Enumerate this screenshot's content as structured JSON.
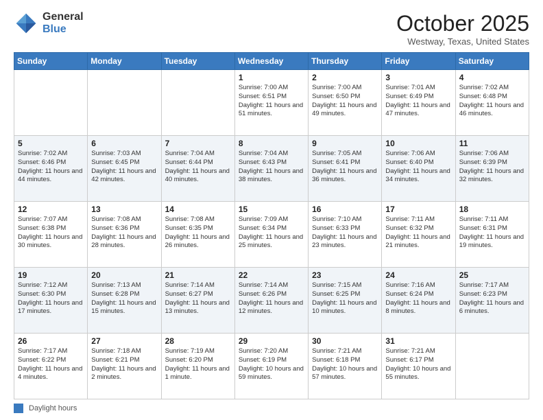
{
  "logo": {
    "general": "General",
    "blue": "Blue"
  },
  "header": {
    "month": "October 2025",
    "location": "Westway, Texas, United States"
  },
  "weekdays": [
    "Sunday",
    "Monday",
    "Tuesday",
    "Wednesday",
    "Thursday",
    "Friday",
    "Saturday"
  ],
  "footer": {
    "legend": "Daylight hours"
  },
  "weeks": [
    [
      {
        "day": "",
        "info": ""
      },
      {
        "day": "",
        "info": ""
      },
      {
        "day": "",
        "info": ""
      },
      {
        "day": "1",
        "info": "Sunrise: 7:00 AM\nSunset: 6:51 PM\nDaylight: 11 hours\nand 51 minutes."
      },
      {
        "day": "2",
        "info": "Sunrise: 7:00 AM\nSunset: 6:50 PM\nDaylight: 11 hours\nand 49 minutes."
      },
      {
        "day": "3",
        "info": "Sunrise: 7:01 AM\nSunset: 6:49 PM\nDaylight: 11 hours\nand 47 minutes."
      },
      {
        "day": "4",
        "info": "Sunrise: 7:02 AM\nSunset: 6:48 PM\nDaylight: 11 hours\nand 46 minutes."
      }
    ],
    [
      {
        "day": "5",
        "info": "Sunrise: 7:02 AM\nSunset: 6:46 PM\nDaylight: 11 hours\nand 44 minutes."
      },
      {
        "day": "6",
        "info": "Sunrise: 7:03 AM\nSunset: 6:45 PM\nDaylight: 11 hours\nand 42 minutes."
      },
      {
        "day": "7",
        "info": "Sunrise: 7:04 AM\nSunset: 6:44 PM\nDaylight: 11 hours\nand 40 minutes."
      },
      {
        "day": "8",
        "info": "Sunrise: 7:04 AM\nSunset: 6:43 PM\nDaylight: 11 hours\nand 38 minutes."
      },
      {
        "day": "9",
        "info": "Sunrise: 7:05 AM\nSunset: 6:41 PM\nDaylight: 11 hours\nand 36 minutes."
      },
      {
        "day": "10",
        "info": "Sunrise: 7:06 AM\nSunset: 6:40 PM\nDaylight: 11 hours\nand 34 minutes."
      },
      {
        "day": "11",
        "info": "Sunrise: 7:06 AM\nSunset: 6:39 PM\nDaylight: 11 hours\nand 32 minutes."
      }
    ],
    [
      {
        "day": "12",
        "info": "Sunrise: 7:07 AM\nSunset: 6:38 PM\nDaylight: 11 hours\nand 30 minutes."
      },
      {
        "day": "13",
        "info": "Sunrise: 7:08 AM\nSunset: 6:36 PM\nDaylight: 11 hours\nand 28 minutes."
      },
      {
        "day": "14",
        "info": "Sunrise: 7:08 AM\nSunset: 6:35 PM\nDaylight: 11 hours\nand 26 minutes."
      },
      {
        "day": "15",
        "info": "Sunrise: 7:09 AM\nSunset: 6:34 PM\nDaylight: 11 hours\nand 25 minutes."
      },
      {
        "day": "16",
        "info": "Sunrise: 7:10 AM\nSunset: 6:33 PM\nDaylight: 11 hours\nand 23 minutes."
      },
      {
        "day": "17",
        "info": "Sunrise: 7:11 AM\nSunset: 6:32 PM\nDaylight: 11 hours\nand 21 minutes."
      },
      {
        "day": "18",
        "info": "Sunrise: 7:11 AM\nSunset: 6:31 PM\nDaylight: 11 hours\nand 19 minutes."
      }
    ],
    [
      {
        "day": "19",
        "info": "Sunrise: 7:12 AM\nSunset: 6:30 PM\nDaylight: 11 hours\nand 17 minutes."
      },
      {
        "day": "20",
        "info": "Sunrise: 7:13 AM\nSunset: 6:28 PM\nDaylight: 11 hours\nand 15 minutes."
      },
      {
        "day": "21",
        "info": "Sunrise: 7:14 AM\nSunset: 6:27 PM\nDaylight: 11 hours\nand 13 minutes."
      },
      {
        "day": "22",
        "info": "Sunrise: 7:14 AM\nSunset: 6:26 PM\nDaylight: 11 hours\nand 12 minutes."
      },
      {
        "day": "23",
        "info": "Sunrise: 7:15 AM\nSunset: 6:25 PM\nDaylight: 11 hours\nand 10 minutes."
      },
      {
        "day": "24",
        "info": "Sunrise: 7:16 AM\nSunset: 6:24 PM\nDaylight: 11 hours\nand 8 minutes."
      },
      {
        "day": "25",
        "info": "Sunrise: 7:17 AM\nSunset: 6:23 PM\nDaylight: 11 hours\nand 6 minutes."
      }
    ],
    [
      {
        "day": "26",
        "info": "Sunrise: 7:17 AM\nSunset: 6:22 PM\nDaylight: 11 hours\nand 4 minutes."
      },
      {
        "day": "27",
        "info": "Sunrise: 7:18 AM\nSunset: 6:21 PM\nDaylight: 11 hours\nand 2 minutes."
      },
      {
        "day": "28",
        "info": "Sunrise: 7:19 AM\nSunset: 6:20 PM\nDaylight: 11 hours\nand 1 minute."
      },
      {
        "day": "29",
        "info": "Sunrise: 7:20 AM\nSunset: 6:19 PM\nDaylight: 10 hours\nand 59 minutes."
      },
      {
        "day": "30",
        "info": "Sunrise: 7:21 AM\nSunset: 6:18 PM\nDaylight: 10 hours\nand 57 minutes."
      },
      {
        "day": "31",
        "info": "Sunrise: 7:21 AM\nSunset: 6:17 PM\nDaylight: 10 hours\nand 55 minutes."
      },
      {
        "day": "",
        "info": ""
      }
    ]
  ]
}
